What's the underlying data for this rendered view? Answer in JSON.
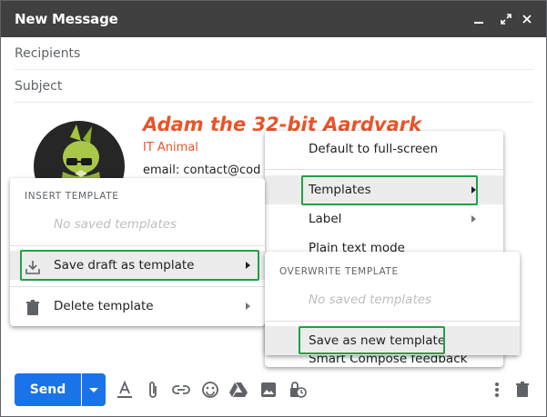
{
  "window": {
    "title": "New Message"
  },
  "fields": {
    "recipients_placeholder": "Recipients",
    "subject_placeholder": "Subject"
  },
  "signature": {
    "name": "Adam the 32-bit Aardvark",
    "role": "IT Animal",
    "email": "email: contact@cod"
  },
  "insert_menu": {
    "header": "INSERT TEMPLATE",
    "empty": "No saved templates",
    "save_draft_label": "Save draft as template",
    "delete_label": "Delete template"
  },
  "more_menu": {
    "default_fullscreen": "Default to full-screen",
    "templates": "Templates",
    "label": "Label",
    "plain_text": "Plain text mode",
    "smart_compose": "Smart Compose feedback"
  },
  "overwrite_menu": {
    "header": "OVERWRITE TEMPLATE",
    "empty": "No saved templates",
    "save_new_label": "Save as new template"
  },
  "toolbar": {
    "send_label": "Send"
  },
  "colors": {
    "accent": "#1a73e8",
    "highlight": "#22a045",
    "signature": "#e8542a",
    "titlebar": "#404040"
  }
}
